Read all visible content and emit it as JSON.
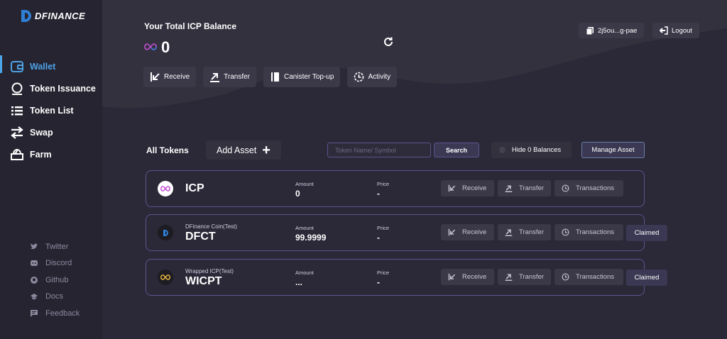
{
  "app": {
    "name": "DFINANCE"
  },
  "sidebar": {
    "items": [
      {
        "label": "Wallet",
        "icon": "wallet-icon",
        "active": true
      },
      {
        "label": "Token Issuance",
        "icon": "token-issuance-icon"
      },
      {
        "label": "Token List",
        "icon": "list-icon"
      },
      {
        "label": "Swap",
        "icon": "swap-icon"
      },
      {
        "label": "Farm",
        "icon": "farm-icon"
      }
    ],
    "social": [
      {
        "label": "Twitter",
        "icon": "twitter-icon"
      },
      {
        "label": "Discord",
        "icon": "discord-icon"
      },
      {
        "label": "Github",
        "icon": "github-icon"
      },
      {
        "label": "Docs",
        "icon": "docs-icon"
      },
      {
        "label": "Feedback",
        "icon": "feedback-icon"
      }
    ]
  },
  "header": {
    "balance_title": "Your Total ICP Balance",
    "balance_value": "0",
    "account_label": "2j5ou...g-pae",
    "logout_label": "Logout",
    "actions": [
      "Receive",
      "Transfer",
      "Canister Top-up",
      "Activity"
    ]
  },
  "toolbar": {
    "all_tokens_label": "All Tokens",
    "add_asset_label": "Add Asset",
    "search_placeholder": "Token Name/ Symbol",
    "search_label": "Search",
    "hide_zero_label": "Hide 0 Balances",
    "manage_asset_label": "Manage Asset"
  },
  "tokens": [
    {
      "name": "",
      "symbol": "ICP",
      "amount_label": "Amount",
      "amount": "0",
      "price_label": "Price",
      "price": "-",
      "claimed": null
    },
    {
      "name": "DFinance Coin(Test)",
      "symbol": "DFCT",
      "amount_label": "Amount",
      "amount": "99.9999",
      "price_label": "Price",
      "price": "-",
      "claimed": "Claimed"
    },
    {
      "name": "Wrapped ICP(Test)",
      "symbol": "WICPT",
      "amount_label": "Amount",
      "amount": "...",
      "price_label": "Price",
      "price": "-",
      "claimed": "Claimed"
    }
  ],
  "token_actions": {
    "receive": "Receive",
    "transfer": "Transfer",
    "transactions": "Transactions"
  },
  "colors": {
    "accent": "#4da3e8",
    "background": "#2b2837",
    "sidebar": "#262430",
    "border": "#5c5490"
  }
}
